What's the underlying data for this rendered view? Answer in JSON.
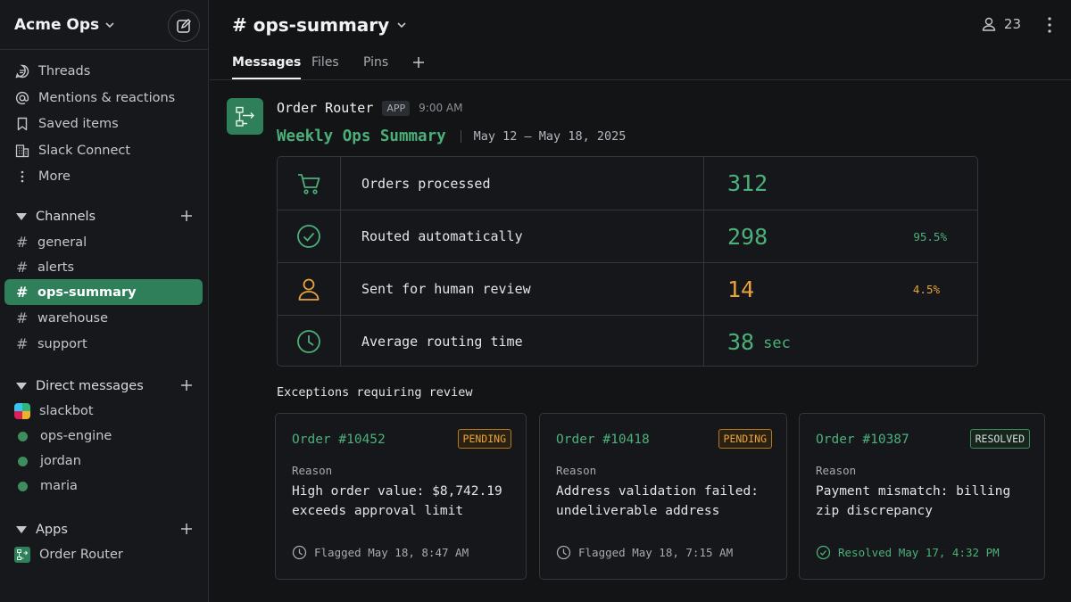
{
  "workspace": {
    "name": "Acme Ops"
  },
  "sidebar": {
    "nav": [
      {
        "label": "Threads",
        "icon": "threads-icon"
      },
      {
        "label": "Mentions & reactions",
        "icon": "at-icon"
      },
      {
        "label": "Saved items",
        "icon": "bookmark-icon"
      },
      {
        "label": "Slack Connect",
        "icon": "building-icon"
      },
      {
        "label": "More",
        "icon": "more-vertical-icon"
      }
    ],
    "channels_title": "Channels",
    "channels": [
      "general",
      "alerts",
      "ops-summary",
      "warehouse",
      "support"
    ],
    "active_channel": "ops-summary",
    "dms_title": "Direct messages",
    "dms": [
      "slackbot",
      "ops-engine",
      "jordan",
      "maria"
    ],
    "apps_title": "Apps",
    "apps": [
      "Order Router"
    ]
  },
  "header": {
    "channel_title": "# ops-summary",
    "member_count": "23"
  },
  "tabs": [
    "Messages",
    "Files",
    "Pins"
  ],
  "message": {
    "sender": "Order Router",
    "badge": "APP",
    "time": "9:00 AM",
    "summary_title": "Weekly Ops Summary",
    "summary_range": "May 12 – May 18, 2025",
    "metrics": [
      {
        "label": "Orders processed",
        "value": "312",
        "unit": "",
        "pct": "",
        "icon": "cart-icon"
      },
      {
        "label": "Routed automatically",
        "value": "298",
        "unit": "",
        "pct": "95.5%",
        "icon": "check-circle-icon"
      },
      {
        "label": "Sent for human review",
        "value": "14",
        "unit": "",
        "pct": "4.5%",
        "icon": "person-icon"
      },
      {
        "label": "Average routing time",
        "value": "38",
        "unit": "sec",
        "pct": "",
        "icon": "clock-icon"
      }
    ],
    "exceptions_title": "Exceptions requiring review",
    "exceptions": [
      {
        "order": "Order #10452",
        "status": "PENDING",
        "reason_label": "Reason",
        "reason": "High order value: $8,742.19 exceeds approval limit",
        "footer": "Flagged May 18, 8:47 AM"
      },
      {
        "order": "Order #10418",
        "status": "PENDING",
        "reason_label": "Reason",
        "reason": "Address validation failed: undeliverable address",
        "footer": "Flagged May 18, 7:15 AM"
      },
      {
        "order": "Order #10387",
        "status": "RESOLVED",
        "reason_label": "Reason",
        "reason": "Payment mismatch: billing zip discrepancy",
        "footer": "Resolved May 17, 4:32 PM"
      }
    ]
  },
  "colors": {
    "accent_green": "#4cb07a",
    "active_bg": "#2f7f5a",
    "warning_orange": "#e9a33a"
  }
}
